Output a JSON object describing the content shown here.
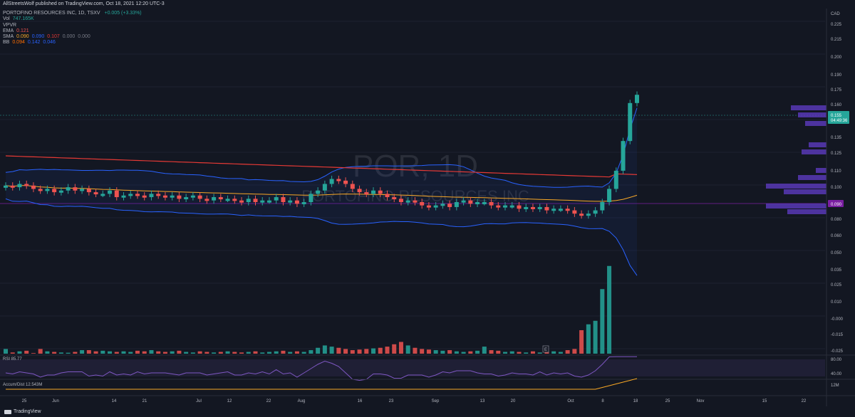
{
  "header": {
    "published_text": "AllStreetsWolf published on TradingView.com, Oct 18, 2021 12:20 UTC-3"
  },
  "legend": {
    "title": "PORTOFINO RESOURCES INC, 1D, TSXV",
    "change": "+0.005 (+3.33%)",
    "vol_label": "Vol",
    "vol_value": "747.165K",
    "vpvr_label": "VPVR",
    "ema_label": "EMA",
    "ema_value": "0.121",
    "sma_label": "SMA",
    "sma_v1": "0.090",
    "sma_v2": "0.090",
    "sma_v3": "0.107",
    "sma_v4": "0.000",
    "sma_v5": "0.000",
    "bb_label": "BB",
    "bb_v1": "0.094",
    "bb_v2": "0.142",
    "bb_v3": "0.046"
  },
  "watermark": {
    "symbol": "POR, 1D",
    "name": "PORTOFINO RESOURCES INC"
  },
  "colors": {
    "up": "#26a69a",
    "down": "#ef5350",
    "sma200": "#e53935",
    "sma50": "#f9a825",
    "bb": "#2962ff",
    "rsi": "#7e57c2",
    "vpvr": "#5c3bbf",
    "accent": "#26a69a"
  },
  "chart_data": [
    {
      "type": "candlestick",
      "title": "POR, 1D",
      "price_axis": {
        "currency": "CAD",
        "ticks": [
          "0.225",
          "0.215",
          "0.200",
          "0.190",
          "0.175",
          "0.160",
          "0.135",
          "0.125",
          "0.110",
          "0.100",
          "0.080",
          "0.060",
          "0.050",
          "0.035",
          "0.025",
          "0.010",
          "-0.000",
          "-0.015",
          "-0.025"
        ]
      },
      "current_price": "0.155",
      "countdown": "04:49:36",
      "level_marker": "0.090",
      "event_marker": "E",
      "x_axis_labels": [
        "25",
        "Jun",
        "14",
        "21",
        "Jul",
        "12",
        "22",
        "Aug",
        "16",
        "23",
        "Sep",
        "13",
        "20",
        "Oct",
        "8",
        "18",
        "25",
        "Nov",
        "15",
        "22"
      ],
      "series": [
        {
          "name": "POR",
          "closes": [
            0.1,
            0.099,
            0.101,
            0.1,
            0.098,
            0.097,
            0.098,
            0.096,
            0.097,
            0.099,
            0.097,
            0.098,
            0.096,
            0.095,
            0.095,
            0.097,
            0.093,
            0.094,
            0.095,
            0.094,
            0.093,
            0.095,
            0.094,
            0.093,
            0.094,
            0.092,
            0.093,
            0.094,
            0.092,
            0.091,
            0.093,
            0.092,
            0.092,
            0.091,
            0.09,
            0.092,
            0.09,
            0.091,
            0.091,
            0.093,
            0.09,
            0.091,
            0.089,
            0.09,
            0.095,
            0.097,
            0.101,
            0.104,
            0.103,
            0.101,
            0.098,
            0.096,
            0.095,
            0.097,
            0.095,
            0.093,
            0.092,
            0.09,
            0.091,
            0.09,
            0.088,
            0.087,
            0.088,
            0.089,
            0.087,
            0.09,
            0.091,
            0.089,
            0.09,
            0.09,
            0.088,
            0.087,
            0.088,
            0.088,
            0.086,
            0.087,
            0.086,
            0.087,
            0.085,
            0.086,
            0.086,
            0.085,
            0.083,
            0.082,
            0.083,
            0.085,
            0.09,
            0.098,
            0.109,
            0.127,
            0.15,
            0.155
          ]
        }
      ]
    },
    {
      "type": "bar",
      "title": "Vol",
      "values_k": [
        40,
        10,
        20,
        25,
        5,
        40,
        20,
        15,
        10,
        8,
        15,
        30,
        30,
        20,
        25,
        20,
        15,
        20,
        15,
        25,
        20,
        30,
        20,
        15,
        20,
        25,
        15,
        10,
        20,
        15,
        10,
        15,
        20,
        15,
        10,
        15,
        20,
        10,
        15,
        20,
        25,
        15,
        20,
        15,
        30,
        50,
        70,
        60,
        50,
        40,
        30,
        35,
        40,
        45,
        50,
        60,
        80,
        100,
        70,
        50,
        40,
        35,
        30,
        25,
        30,
        20,
        15,
        20,
        25,
        60,
        30,
        25,
        15,
        20,
        15,
        10,
        20,
        10,
        15,
        20,
        15,
        30,
        40,
        200,
        250,
        280,
        550,
        747
      ]
    },
    {
      "type": "line",
      "title": "RSI",
      "value_label": "85.77",
      "ticks": [
        "80.00",
        "40.00"
      ]
    },
    {
      "type": "line",
      "title": "Accum/Dist",
      "value_label": "12.543M",
      "tick": "12M"
    }
  ],
  "footer": {
    "brand": "TradingView"
  }
}
